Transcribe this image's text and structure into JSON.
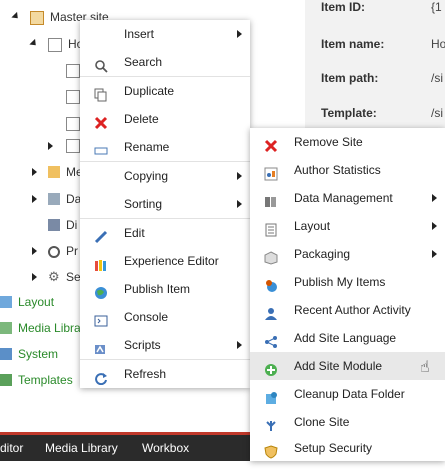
{
  "tree": {
    "root": "Master site",
    "home": "Ho",
    "children": [
      "Me",
      "Da",
      "Di",
      "Pr",
      "Se"
    ],
    "bottom_items": [
      {
        "label": "Layout",
        "color": "#2a8a2a"
      },
      {
        "label": "Media Libra",
        "color": "#2a8a2a"
      },
      {
        "label": "System",
        "color": "#2a8a2a"
      },
      {
        "label": "Templates",
        "color": "#2a8a2a"
      }
    ]
  },
  "details": {
    "item_id_label": "Item ID:",
    "item_id_value": "{1",
    "item_name_label": "Item name:",
    "item_name_value": "Ho",
    "item_path_label": "Item path:",
    "item_path_value": "/si",
    "template_label": "Template:",
    "template_value": "/si"
  },
  "tabs": [
    "ditor",
    "Media Library",
    "Workbox"
  ],
  "context_menu": [
    {
      "label": "Insert",
      "icon": "none",
      "submenu": true
    },
    {
      "label": "Search",
      "icon": "magnifier-icon",
      "submenu": false
    },
    {
      "label": "Duplicate",
      "icon": "duplicate-icon",
      "submenu": false
    },
    {
      "label": "Delete",
      "icon": "red-x-icon",
      "submenu": false
    },
    {
      "label": "Rename",
      "icon": "rename-icon",
      "submenu": false
    },
    {
      "label": "Copying",
      "icon": "none",
      "submenu": true
    },
    {
      "label": "Sorting",
      "icon": "none",
      "submenu": true
    },
    {
      "label": "Edit",
      "icon": "pencil-icon",
      "submenu": false
    },
    {
      "label": "Experience Editor",
      "icon": "crayons-icon",
      "submenu": false
    },
    {
      "label": "Publish Item",
      "icon": "globe-icon",
      "submenu": false
    },
    {
      "label": "Console",
      "icon": "console-icon",
      "submenu": false
    },
    {
      "label": "Scripts",
      "icon": "scripts-icon",
      "submenu": true
    },
    {
      "label": "Refresh",
      "icon": "refresh-icon",
      "submenu": false
    }
  ],
  "scripts_submenu": [
    {
      "label": "Remove Site",
      "icon": "red-x-icon",
      "submenu": false
    },
    {
      "label": "Author Statistics",
      "icon": "chart-icon",
      "submenu": false
    },
    {
      "label": "Data Management",
      "icon": "data-icon",
      "submenu": true
    },
    {
      "label": "Layout",
      "icon": "layout-icon",
      "submenu": true
    },
    {
      "label": "Packaging",
      "icon": "package-icon",
      "submenu": true
    },
    {
      "label": "Publish My Items",
      "icon": "user-globe-icon",
      "submenu": false
    },
    {
      "label": "Recent Author Activity",
      "icon": "user-icon",
      "submenu": false
    },
    {
      "label": "Add Site Language",
      "icon": "share-icon",
      "submenu": false
    },
    {
      "label": "Add Site Module",
      "icon": "green-plus-icon",
      "submenu": false,
      "highlighted": true
    },
    {
      "label": "Cleanup Data Folder",
      "icon": "cleanup-icon",
      "submenu": false
    },
    {
      "label": "Clone Site",
      "icon": "clone-icon",
      "submenu": false
    },
    {
      "label": "Setup Security",
      "icon": "shield-icon",
      "submenu": false
    }
  ]
}
